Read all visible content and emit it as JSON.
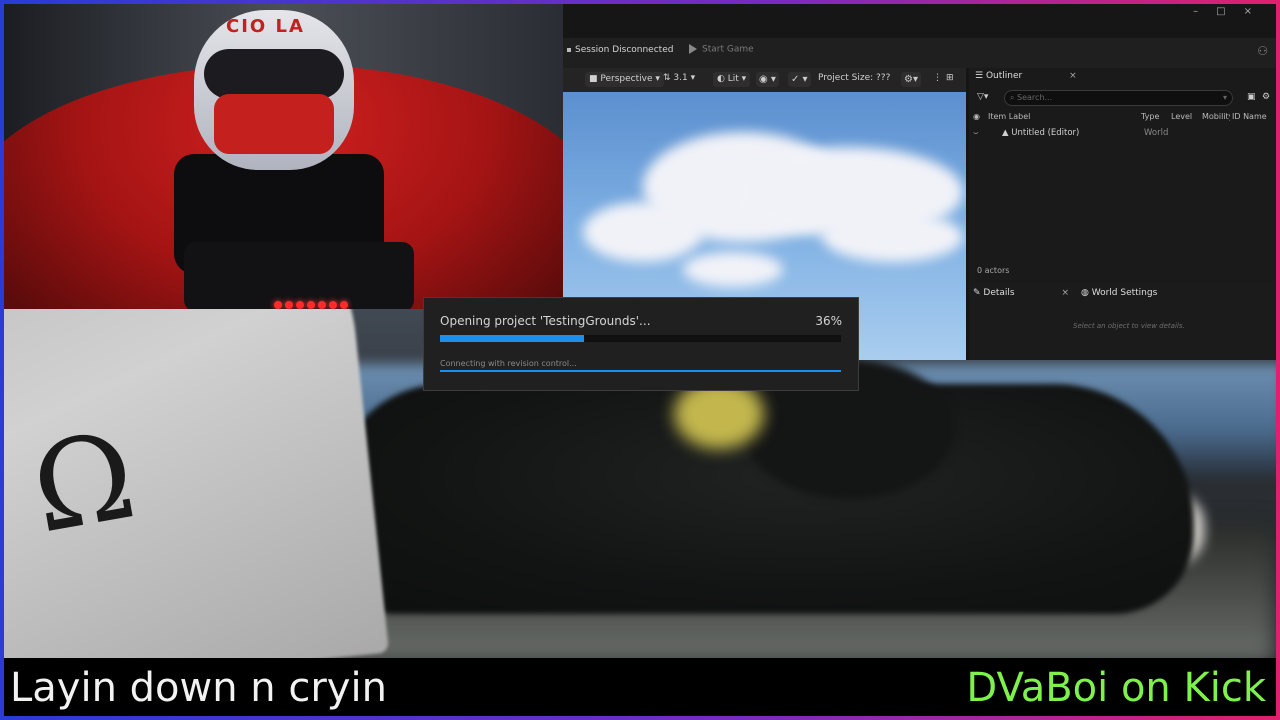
{
  "overlay": {
    "caption_left": "Layin down n cryin",
    "caption_right": "DVaBoi on Kick",
    "caption_right_color": "#7ef24a"
  },
  "f1_cam": {
    "helmet_text": "CIO LA"
  },
  "editor": {
    "session_status": "Session Disconnected",
    "start_game": "Start Game",
    "viewport": {
      "perspective": "Perspective",
      "fov": "3.1",
      "lit": "Lit",
      "project_size": "Project Size: ???"
    },
    "outliner": {
      "tab": "Outliner",
      "search_placeholder": "Search...",
      "columns": [
        "Item Label",
        "Type",
        "Level",
        "Mobility",
        "ID Name"
      ],
      "rows": [
        {
          "label": "Untitled (Editor)",
          "type": "World"
        }
      ],
      "actor_count": "0 actors"
    },
    "details": {
      "tab": "Details",
      "tab2": "World Settings",
      "empty_text": "Select an object to view details."
    }
  },
  "loading": {
    "message": "Opening project 'TestingGrounds'...",
    "percent_label": "36%",
    "progress": 0.36,
    "sub_message": "Connecting with revision control..."
  }
}
